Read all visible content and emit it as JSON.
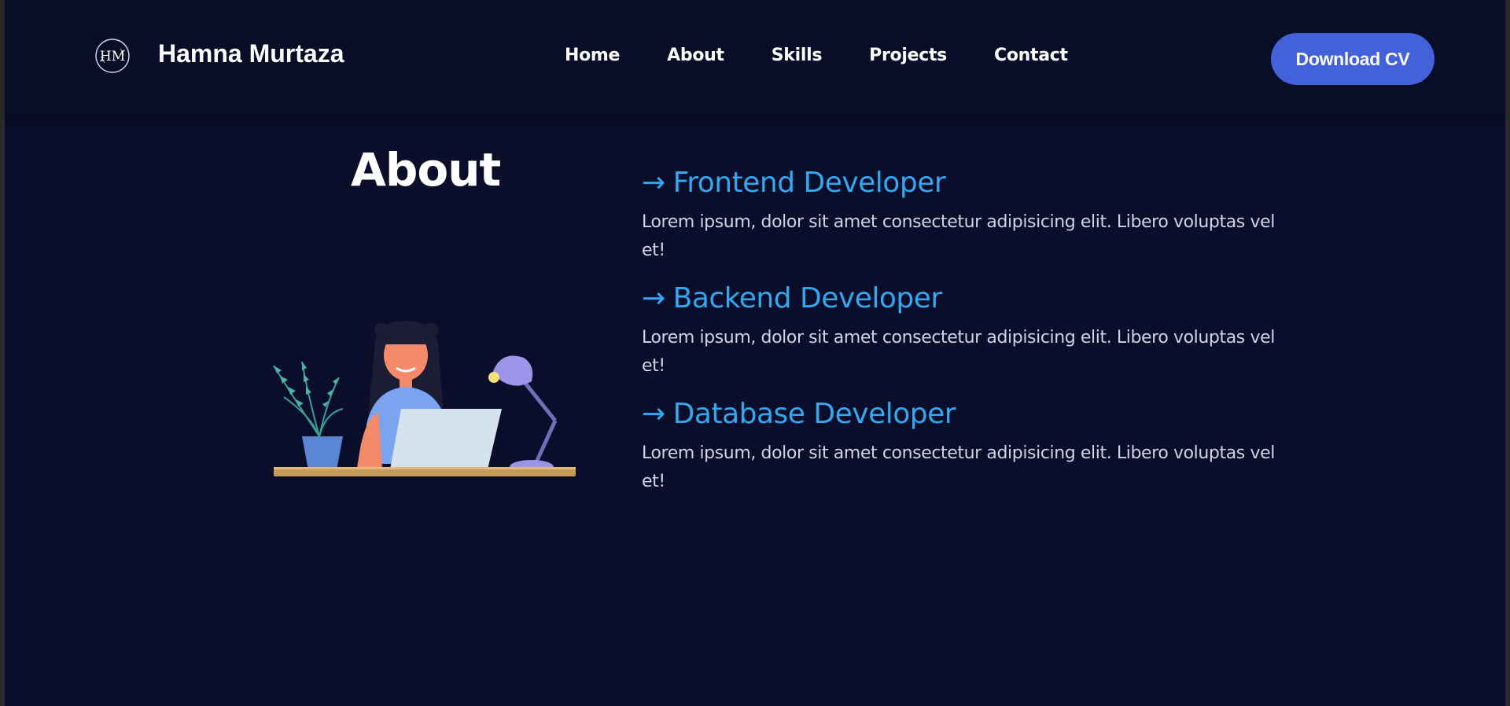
{
  "brand": {
    "logo_text": "HM",
    "name": "Hamna Murtaza"
  },
  "nav": {
    "links": [
      "Home",
      "About",
      "Skills",
      "Projects",
      "Contact"
    ],
    "cv_button": "Download CV"
  },
  "about": {
    "title": "About",
    "roles": [
      {
        "arrow": "→",
        "title": "Frontend Developer",
        "desc": "Lorem ipsum, dolor sit amet consectetur adipisicing elit. Libero voluptas vel et!"
      },
      {
        "arrow": "→",
        "title": "Backend Developer",
        "desc": "Lorem ipsum, dolor sit amet consectetur adipisicing elit. Libero voluptas vel et!"
      },
      {
        "arrow": "→",
        "title": "Database Developer",
        "desc": "Lorem ipsum, dolor sit amet consectetur adipisicing elit. Libero voluptas vel et!"
      }
    ]
  },
  "colors": {
    "background": "#0a0e2a",
    "accent": "#33a8ee",
    "button": "#4361d8"
  },
  "icons": {
    "logo": "hm-monogram-icon",
    "illustration": "developer-at-laptop-illustration"
  }
}
